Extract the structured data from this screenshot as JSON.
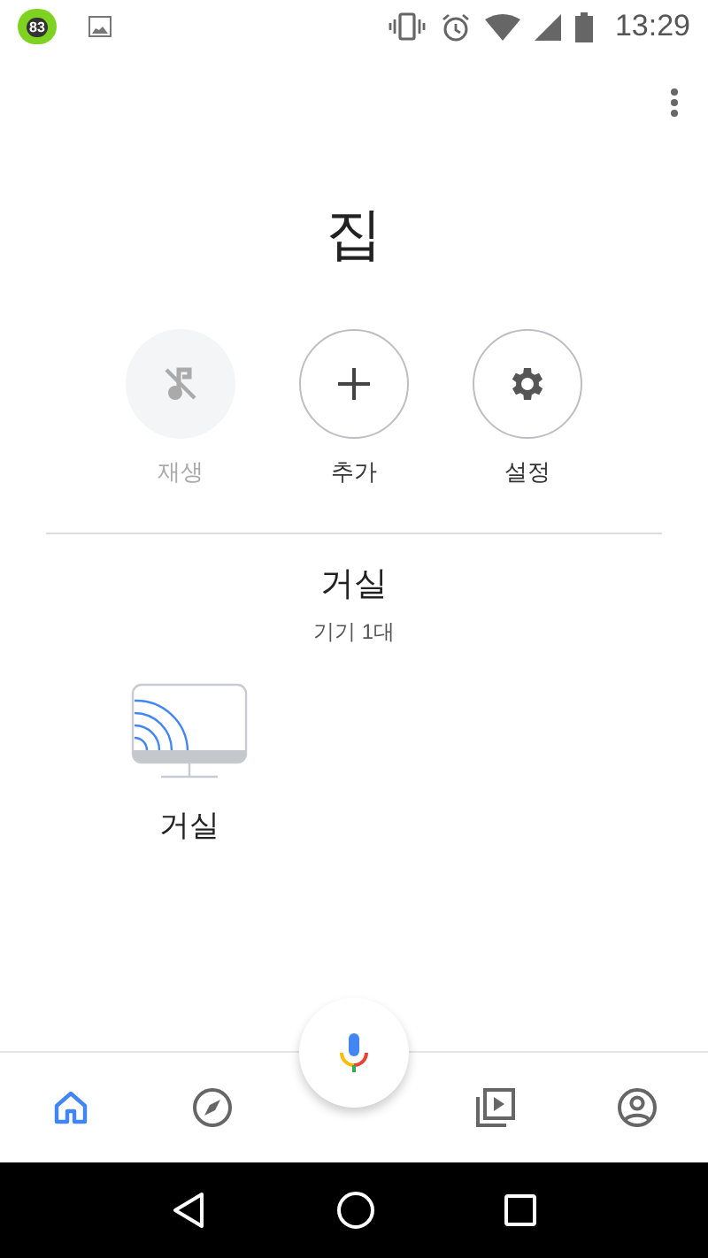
{
  "status_bar": {
    "time": "13:29",
    "notification_badge": "83"
  },
  "home": {
    "title": "집"
  },
  "actions": [
    {
      "kind": "play",
      "label": "재생",
      "disabled": true
    },
    {
      "kind": "add",
      "label": "추가",
      "disabled": false
    },
    {
      "kind": "settings",
      "label": "설정",
      "disabled": false
    }
  ],
  "rooms": [
    {
      "name": "거실",
      "device_count": "기기 1대",
      "devices": [
        {
          "kind": "display",
          "label": "거실"
        }
      ]
    }
  ],
  "bottom_nav": [
    {
      "kind": "home",
      "selected": true
    },
    {
      "kind": "discover",
      "selected": false
    },
    {
      "kind": "media",
      "selected": false
    },
    {
      "kind": "account",
      "selected": false
    }
  ]
}
